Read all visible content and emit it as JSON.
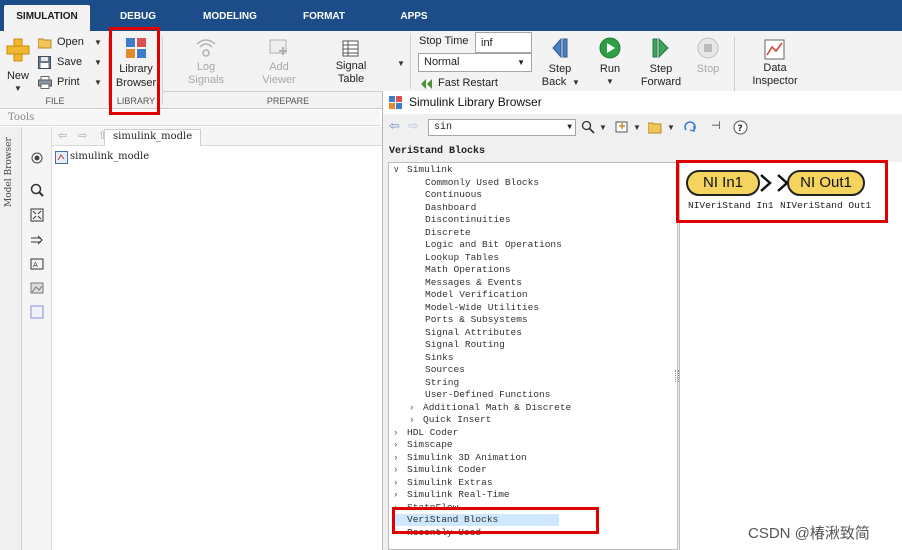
{
  "tabs": [
    "SIMULATION",
    "DEBUG",
    "MODELING",
    "FORMAT",
    "APPS"
  ],
  "ribbon": {
    "new_label": "New",
    "open_label": "Open",
    "save_label": "Save",
    "print_label": "Print",
    "file_section": "FILE",
    "library_browser_label": "Library Browser",
    "library_browser_line1": "Library",
    "library_browser_line2": "Browser",
    "library_section": "LIBRARY",
    "log_signals_line1": "Log",
    "log_signals_line2": "Signals",
    "add_viewer_line1": "Add",
    "add_viewer_line2": "Viewer",
    "signal_table_line1": "Signal",
    "signal_table_line2": "Table",
    "prepare_section": "PREPARE",
    "stop_time_label": "Stop Time",
    "stop_time_value": "inf",
    "mode_value": "Normal",
    "fast_restart_label": "Fast Restart",
    "step_back_line1": "Step",
    "step_back_line2": "Back",
    "run_label": "Run",
    "step_forward_line1": "Step",
    "step_forward_line2": "Forward",
    "stop_label": "Stop",
    "data_inspector_line1": "Data",
    "data_inspector_line2": "Inspector"
  },
  "left": {
    "tools_label": "Tools",
    "model_browser_label": "Model Browser",
    "model_tab": "simulink_modle",
    "model_tree_root": "simulink_modle"
  },
  "library_browser": {
    "title": "Simulink Library Browser",
    "search_value": "sin",
    "header": "VeriStand Blocks",
    "tree": [
      {
        "label": "Simulink",
        "expander": "v",
        "level": 0
      },
      {
        "label": "Commonly Used Blocks",
        "expander": "",
        "level": 2
      },
      {
        "label": "Continuous",
        "expander": "",
        "level": 2
      },
      {
        "label": "Dashboard",
        "expander": "",
        "level": 2
      },
      {
        "label": "Discontinuities",
        "expander": "",
        "level": 2
      },
      {
        "label": "Discrete",
        "expander": "",
        "level": 2
      },
      {
        "label": "Logic and Bit Operations",
        "expander": "",
        "level": 2
      },
      {
        "label": "Lookup Tables",
        "expander": "",
        "level": 2
      },
      {
        "label": "Math Operations",
        "expander": "",
        "level": 2
      },
      {
        "label": "Messages & Events",
        "expander": "",
        "level": 2
      },
      {
        "label": "Model Verification",
        "expander": "",
        "level": 2
      },
      {
        "label": "Model-Wide Utilities",
        "expander": "",
        "level": 2
      },
      {
        "label": "Ports & Subsystems",
        "expander": "",
        "level": 2
      },
      {
        "label": "Signal Attributes",
        "expander": "",
        "level": 2
      },
      {
        "label": "Signal Routing",
        "expander": "",
        "level": 2
      },
      {
        "label": "Sinks",
        "expander": "",
        "level": 2
      },
      {
        "label": "Sources",
        "expander": "",
        "level": 2
      },
      {
        "label": "String",
        "expander": "",
        "level": 2
      },
      {
        "label": "User-Defined Functions",
        "expander": "",
        "level": 2
      },
      {
        "label": "Additional Math & Discrete",
        "expander": ">",
        "level": 1
      },
      {
        "label": "Quick Insert",
        "expander": ">",
        "level": 1
      },
      {
        "label": "HDL Coder",
        "expander": ">",
        "level": 0
      },
      {
        "label": "Simscape",
        "expander": ">",
        "level": 0
      },
      {
        "label": "Simulink 3D Animation",
        "expander": ">",
        "level": 0
      },
      {
        "label": "Simulink Coder",
        "expander": ">",
        "level": 0
      },
      {
        "label": "Simulink Extras",
        "expander": ">",
        "level": 0
      },
      {
        "label": "Simulink Real-Time",
        "expander": ">",
        "level": 0
      },
      {
        "label": "StateFlow",
        "expander": ">",
        "level": 0
      },
      {
        "label": "VeriStand Blocks",
        "expander": "",
        "level": 0,
        "selected": true
      },
      {
        "label": "Recently Used",
        "expander": "",
        "level": 0
      }
    ],
    "blocks": [
      {
        "text": "NI In1",
        "label": "NIVeriStand In1"
      },
      {
        "text": "NI Out1",
        "label": "NIVeriStand Out1"
      }
    ]
  },
  "watermark": "CSDN @椿湫致简",
  "colors": {
    "tabbar": "#1d4d88",
    "highlight_box": "#e00000",
    "block_fill": "#f4d35e",
    "selection": "#cde8ff"
  }
}
